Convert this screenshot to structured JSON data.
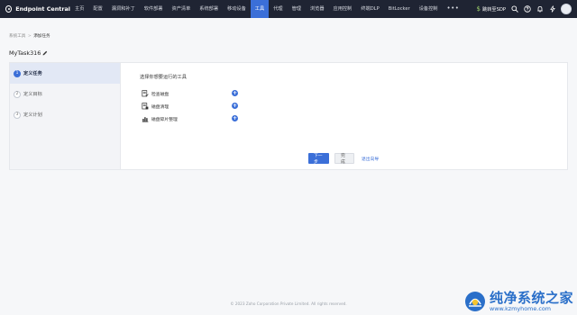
{
  "app": {
    "brand": "Endpoint Central"
  },
  "nav": {
    "items": [
      "主页",
      "配置",
      "漏洞和补丁",
      "软件部署",
      "资产清单",
      "系统部署",
      "移动设备",
      "工具",
      "代理",
      "管理",
      "浏览器",
      "应用控制",
      "终端DLP",
      "BitLocker",
      "设备控制"
    ],
    "active_index": 7,
    "more": "•••"
  },
  "top_right": {
    "sdp_label": "跳转至SDP"
  },
  "breadcrumb": {
    "parent": "系统工具",
    "separator": ">",
    "current": "添加任务"
  },
  "task": {
    "title": "MyTask316"
  },
  "steps": [
    {
      "num": "1",
      "label": "定义任务"
    },
    {
      "num": "2",
      "label": "定义目标"
    },
    {
      "num": "3",
      "label": "定义计划"
    }
  ],
  "content": {
    "heading": "选择你想要运行的工具",
    "tools": [
      {
        "label": "检查磁盘",
        "icon": "disk-check-icon"
      },
      {
        "label": "磁盘清理",
        "icon": "disk-cleanup-icon"
      },
      {
        "label": "磁盘碎片整理",
        "icon": "defrag-icon"
      }
    ],
    "add_symbol": "+"
  },
  "actions": {
    "next": "下一步",
    "finish": "完成",
    "exit": "退出向导"
  },
  "footer": {
    "text": "© 2023 Zoho Corporation Private Limited.  All rights reserved."
  },
  "watermark": {
    "title": "纯净系统之家",
    "url": "www.kzmyhome.com"
  },
  "colors": {
    "nav_bg": "#1f2433",
    "accent": "#3b6fd8",
    "step_active_bg": "#e2e8f5"
  }
}
